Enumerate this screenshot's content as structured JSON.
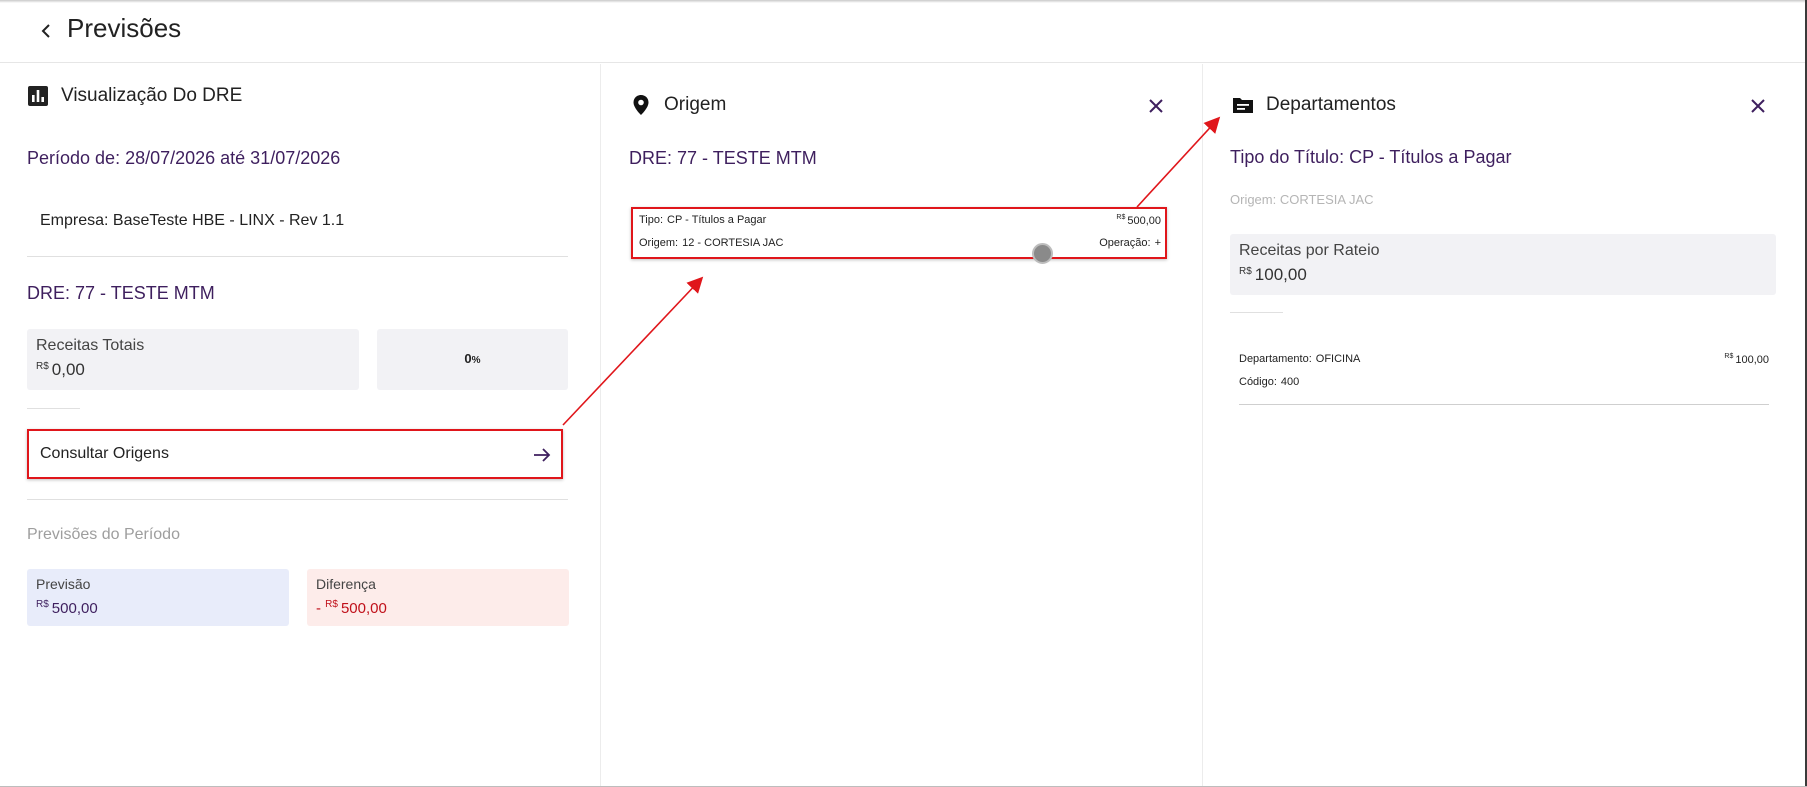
{
  "page": {
    "title": "Previsões"
  },
  "dre_panel": {
    "header": "Visualização Do DRE",
    "periodo": "Período de: 28/07/2026 até 31/07/2026",
    "empresa_label": "Empresa:",
    "empresa_value": "BaseTeste HBE - LINX - Rev 1.1",
    "dre_title": "DRE: 77 - TESTE MTM",
    "receitas_label": "Receitas Totais",
    "currency": "R$",
    "receitas_value": "0,00",
    "percent": "0",
    "percent_sign": "%",
    "consultar_label": "Consultar Origens",
    "previsoes_heading": "Previsões do Período",
    "previsao_label": "Previsão",
    "previsao_value": "500,00",
    "diferenca_label": "Diferença",
    "diferenca_prefix": "-",
    "diferenca_value": "500,00"
  },
  "origem_panel": {
    "header": "Origem",
    "dre_title": "DRE: 77 - TESTE MTM",
    "item": {
      "tipo_label": "Tipo:",
      "tipo_value": "CP - Títulos a Pagar",
      "currency": "R$",
      "valor": "500,00",
      "origem_label": "Origem:",
      "origem_value": "12 - CORTESIA JAC",
      "operacao_label": "Operação:",
      "operacao_value": "+"
    }
  },
  "departamentos_panel": {
    "header": "Departamentos",
    "tipo_titulo": "Tipo do Título: CP - Títulos a Pagar",
    "origem": "Origem: CORTESIA JAC",
    "receitas_label": "Receitas por Rateio",
    "currency": "R$",
    "receitas_value": "100,00",
    "item": {
      "departamento_label": "Departamento:",
      "departamento_value": "OFICINA",
      "currency": "R$",
      "valor": "100,00",
      "codigo_label": "Código:",
      "codigo_value": "400"
    }
  },
  "colors": {
    "accent_purple": "#3e1f5e",
    "highlight_red": "#e0161b",
    "previsao_bg": "#e8ecfa",
    "diferenca_bg": "#fdecea",
    "diferenca_text": "#c0101a"
  }
}
